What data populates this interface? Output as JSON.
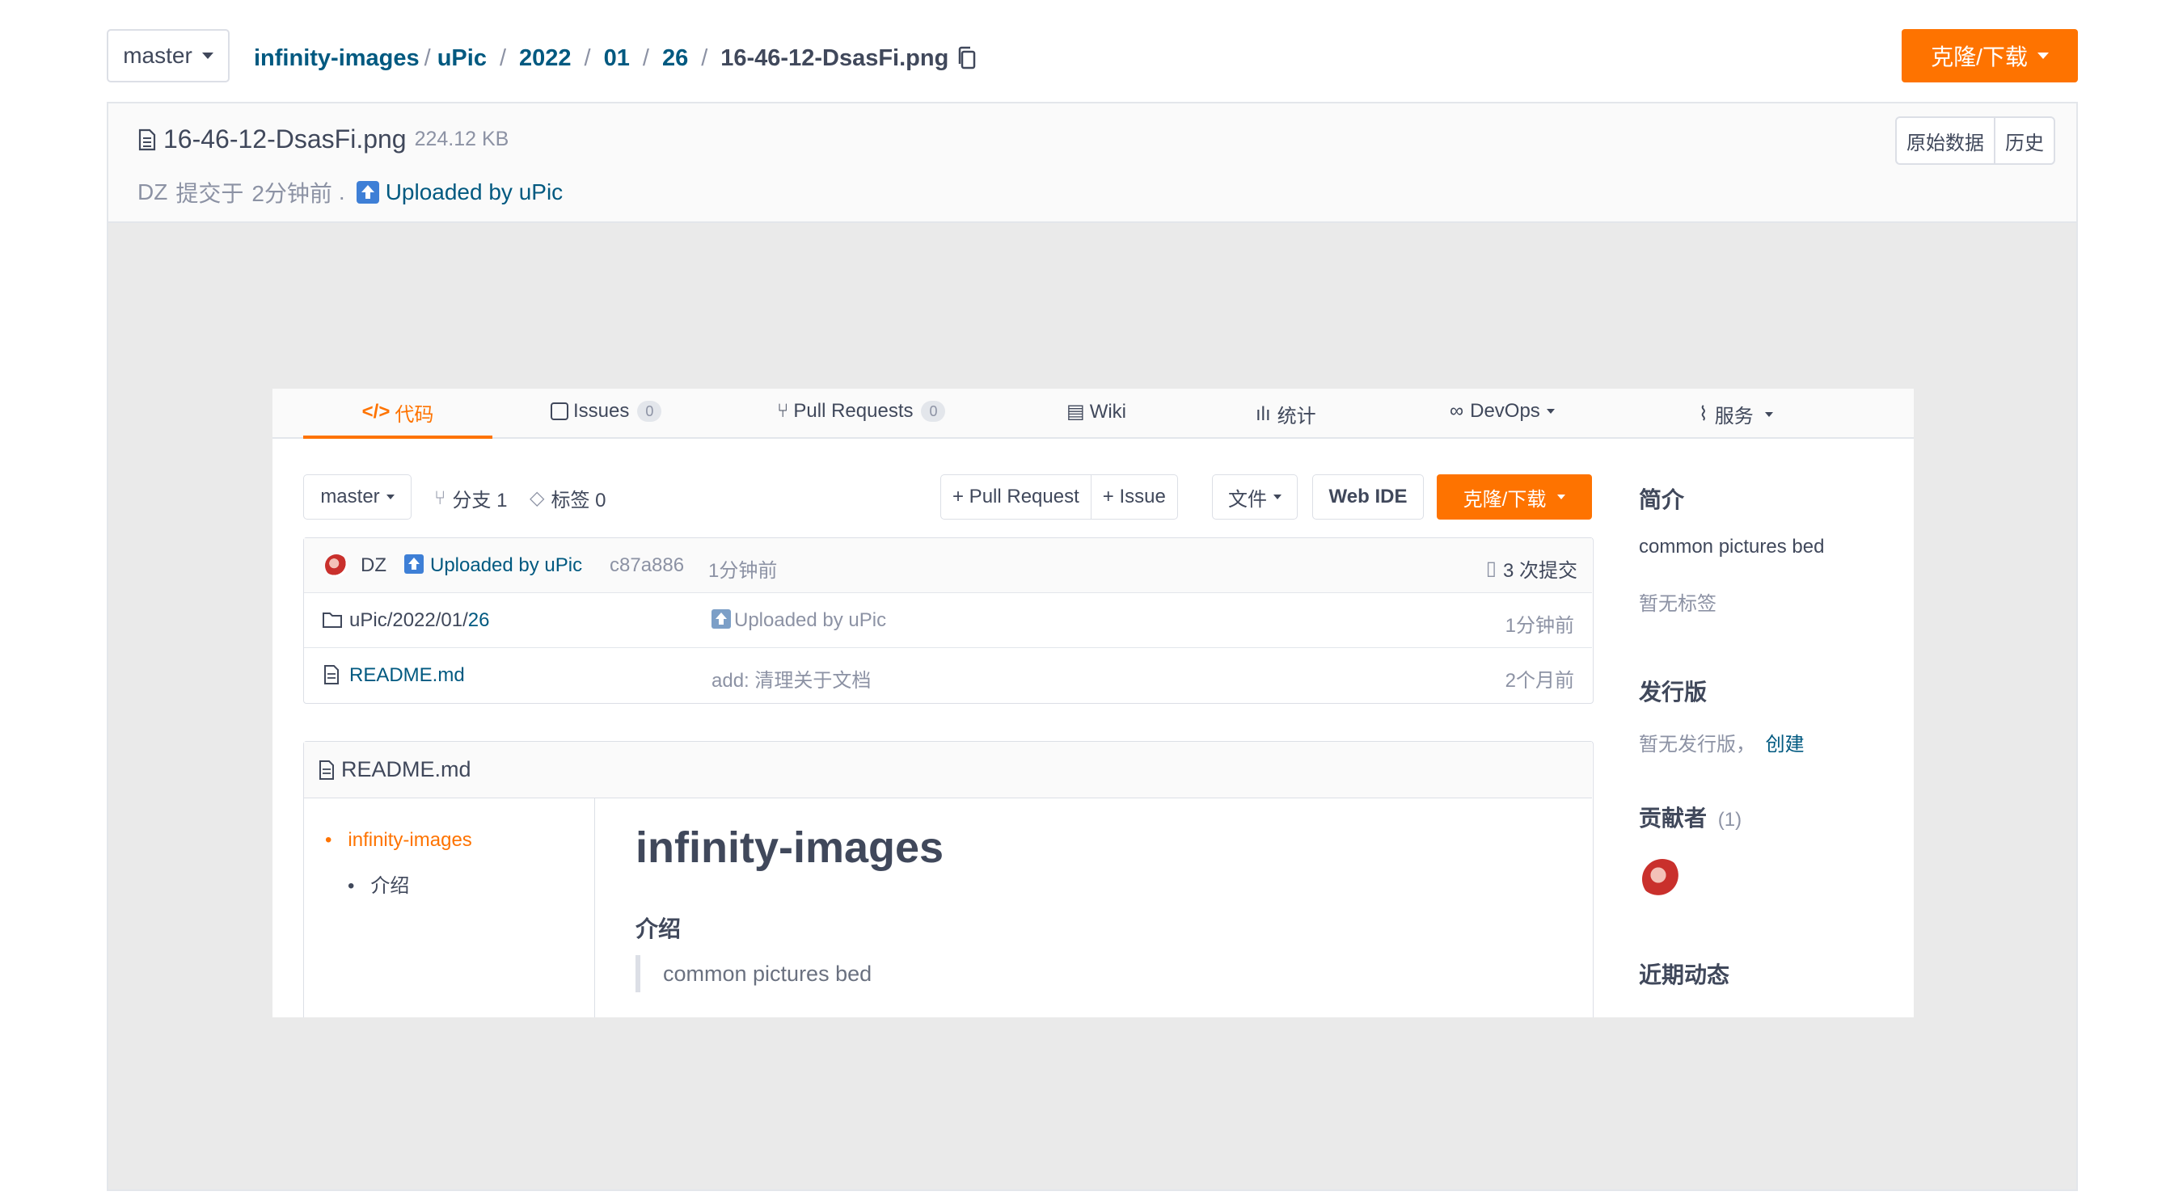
{
  "top": {
    "branch": "master",
    "breadcrumb": [
      "infinity-images",
      "uPic",
      "2022",
      "01",
      "26"
    ],
    "filename": "16-46-12-DsasFi.png",
    "clone_btn": "克隆/下载"
  },
  "file": {
    "name": "16-46-12-DsasFi.png",
    "size": "224.12 KB",
    "raw_btn": "原始数据",
    "history_btn": "历史",
    "author": "DZ",
    "commit_prefix": "提交于",
    "time": "2分钟前",
    "dot": ".",
    "commit_msg": "Uploaded by uPic"
  },
  "preview": {
    "tabs": [
      {
        "label": "代码",
        "icon": "code-icon"
      },
      {
        "label": "Issues",
        "badge": "0",
        "icon": "issues-icon"
      },
      {
        "label": "Pull Requests",
        "badge": "0",
        "icon": "pull-request-icon"
      },
      {
        "label": "Wiki",
        "icon": "wiki-icon"
      },
      {
        "label": "统计",
        "icon": "stats-icon"
      },
      {
        "label": "DevOps",
        "icon": "infinity-icon"
      },
      {
        "label": "服务",
        "icon": "pulse-icon"
      }
    ],
    "toolbar": {
      "branch": "master",
      "branches": "分支 1",
      "tags": "标签 0",
      "pull_request": "+ Pull Request",
      "issue": "+ Issue",
      "file": "文件",
      "web_ide": "Web IDE",
      "clone": "克隆/下载"
    },
    "commit": {
      "author": "DZ",
      "message": "Uploaded by uPic",
      "hash": "c87a886",
      "time": "1分钟前",
      "count": "3 次提交"
    },
    "files": [
      {
        "name_prefix": "uPic/2022/01/",
        "name_last": "26",
        "message": "Uploaded by uPic",
        "time": "1分钟前",
        "type": "folder"
      },
      {
        "name_prefix": "",
        "name_last": "README.md",
        "message": "add: 清理关于文档",
        "time": "2个月前",
        "type": "file"
      }
    ],
    "readme": {
      "header": "README.md",
      "toc": [
        "infinity-images",
        "介绍"
      ],
      "title": "infinity-images",
      "subtitle": "介绍",
      "quote": "common pictures bed"
    },
    "sidebar": {
      "intro_title": "简介",
      "intro_desc": "common pictures bed",
      "no_tags": "暂无标签",
      "release_title": "发行版",
      "no_release": "暂无发行版，",
      "create": "创建",
      "contributors_title": "贡献者",
      "contributors_count": "(1)",
      "activity_title": "近期动态"
    }
  }
}
